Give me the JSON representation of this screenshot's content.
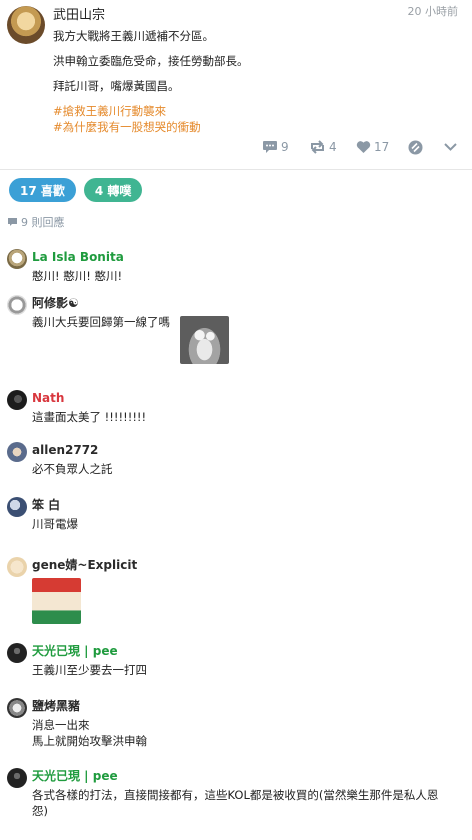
{
  "post": {
    "author": "武田山宗",
    "time": "20 小時前",
    "lines": [
      "我方大戰將王義川遞補不分區。",
      "洪申翰立委臨危受命，接任勞動部長。",
      "拜託川哥，嘴爆黃國昌。"
    ],
    "hashtags": [
      "#搶救王義川行動襲來",
      "#為什麼我有一股想哭的衝動"
    ],
    "actions": {
      "comment_count": "9",
      "repost_count": "4",
      "like_count": "17"
    }
  },
  "stats": {
    "likes_label": "17 喜歡",
    "shares_label": "4 轉噗"
  },
  "replies": {
    "count_label": "9 則回應"
  },
  "comments": [
    {
      "name": "La Isla Bonita",
      "text": "憨川! 憨川! 憨川!",
      "name_color": "#1f9b3e",
      "avatar": "sombrero-avatar"
    },
    {
      "name": "阿修影☯",
      "text": "義川大兵要回歸第一線了嗎",
      "name_color": "#2b2b2b",
      "avatar": "ash-avatar",
      "has_image": true
    },
    {
      "name": "Nath",
      "text": "這畫面太美了 !!!!!!!!!",
      "name_color": "#d8373e",
      "avatar": "dark-avatar"
    },
    {
      "name": "allen2772",
      "text": "必不負眾人之託",
      "name_color": "#2b2b2b",
      "avatar": "cat-avatar"
    },
    {
      "name": "笨 白",
      "text": "川哥電爆",
      "name_color": "#2b2b2b",
      "avatar": "moon-avatar"
    },
    {
      "name": "gene婧~Explicit",
      "text": "",
      "name_color": "#2b2b2b",
      "avatar": "gene-avatar",
      "has_image": true
    },
    {
      "name": "天光已現 | pee",
      "text": "王義川至少要去一打四",
      "name_color": "#1f9b3e",
      "avatar": "sky-avatar"
    },
    {
      "name": "鹽烤黑豬",
      "text": "消息一出來\n馬上就開始攻擊洪申翰",
      "name_color": "#2b2b2b",
      "avatar": "pig-avatar"
    },
    {
      "name": "天光已現 | pee",
      "text": "各式各樣的打法，直接間接都有，這些KOL都是被收買的(當然樂生那件是私人恩\n怨)",
      "name_color": "#1f9b3e",
      "avatar": "sky-avatar"
    }
  ],
  "icons": {
    "comment": "speech-bubble-icon",
    "repost": "repost-arrows-icon",
    "like": "heart-icon",
    "mute": "mute-icon",
    "expand": "chevron-down-icon"
  },
  "colors": {
    "hashtag": "#e58a2c",
    "likes_pill": "#3ba0d6",
    "shares_pill": "#40b592",
    "muted": "#8b98a5"
  }
}
